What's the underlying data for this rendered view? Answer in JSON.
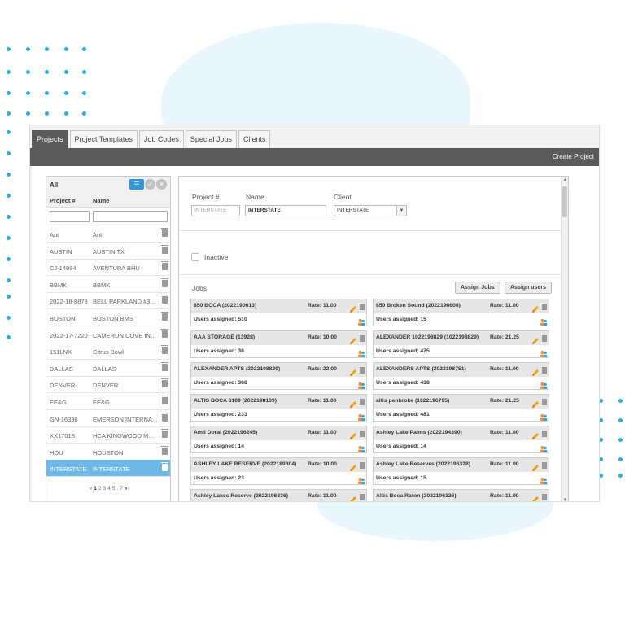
{
  "tabs": [
    "Projects",
    "Project Templates",
    "Job Codes",
    "Special Jobs",
    "Clients"
  ],
  "active_tab": 0,
  "toolbar": {
    "create_project": "Create Project"
  },
  "list": {
    "filter_label": "All",
    "col_project": "Project #",
    "col_name": "Name",
    "filter_icons": [
      "list-icon",
      "check-circle-icon",
      "close-circle-icon"
    ],
    "rows": [
      {
        "num": "Ant",
        "name": "Ant"
      },
      {
        "num": "AUSTIN",
        "name": "AUSTIN TX"
      },
      {
        "num": "CJ-14984",
        "name": "AVENTURA BHU"
      },
      {
        "num": "BBMK",
        "name": "BBMK"
      },
      {
        "num": "2022-18-8879",
        "name": "BELL PARKLAND #3215"
      },
      {
        "num": "BOSTON",
        "name": "BOSTON BMS"
      },
      {
        "num": "2022-17-7220",
        "name": "CAMERUN COVE INT..."
      },
      {
        "num": "151LNX",
        "name": "Citrus Bowl"
      },
      {
        "num": "DALLAS",
        "name": "DALLAS"
      },
      {
        "num": "DENVER",
        "name": "DENVER"
      },
      {
        "num": "EE&G",
        "name": "EE&G"
      },
      {
        "num": "GN-16336",
        "name": "EMERSON INTERNAT..."
      },
      {
        "num": "XX17018",
        "name": "HCA KINGWOOD MED..."
      },
      {
        "num": "HOU",
        "name": "HOUSTON"
      },
      {
        "num": "INTERSTATE",
        "name": "INTERSTATE"
      }
    ],
    "selected_index": 14,
    "pager": {
      "prev": "«",
      "pages": [
        "1",
        "2",
        "3",
        "4",
        "5",
        ".",
        "7"
      ],
      "current": "1",
      "next": "»"
    }
  },
  "detail": {
    "project_label": "Project #",
    "name_label": "Name",
    "client_label": "Client",
    "project_value": "INTERSTATE",
    "name_value": "INTERSTATE",
    "client_value": "INTERSTATE",
    "inactive_label": "Inactive",
    "jobs_label": "Jobs",
    "assign_jobs": "Assign Jobs",
    "assign_users": "Assign users",
    "jobs": [
      {
        "name": "850 BOCA (2022190613)",
        "rate": "Rate: 11.00",
        "users": "Users assigned: 510"
      },
      {
        "name": "850 Broken Sound (2022196608)",
        "rate": "Rate: 11.00",
        "users": "Users assigned: 15"
      },
      {
        "name": "AAA STORAGE (13928)",
        "rate": "Rate: 10.00",
        "users": "Users assigned: 38"
      },
      {
        "name": "ALEXANDER 1022198829 (1022198829)",
        "rate": "Rate: 21.25",
        "users": "Users assigned: 475"
      },
      {
        "name": "ALEXANDER APTS (2022198829)",
        "rate": "Rate: 22.00",
        "users": "Users assigned: 368"
      },
      {
        "name": "ALEXANDERS APTS (2022198751)",
        "rate": "Rate: 11.00",
        "users": "Users assigned: 438"
      },
      {
        "name": "ALTIS BOCA 8109 (2022198109)",
        "rate": "Rate: 11.00",
        "users": "Users assigned: 233"
      },
      {
        "name": "altis penbroke (1022196795)",
        "rate": "Rate: 21.25",
        "users": "Users assigned: 481"
      },
      {
        "name": "Amli Doral (2022196245)",
        "rate": "Rate: 11.00",
        "users": "Users assigned: 14"
      },
      {
        "name": "Ashley Lake Palms (2022194390)",
        "rate": "Rate: 11.00",
        "users": "Users assigned: 14"
      },
      {
        "name": "ASHLEY LAKE RESERVE (2022189304)",
        "rate": "Rate: 10.00",
        "users": "Users assigned: 23"
      },
      {
        "name": "Ashley Lake Reserves (2022196328)",
        "rate": "Rate: 11.00",
        "users": "Users assigned: 15"
      },
      {
        "name": "Ashley Lakes Reserve (2022196336)",
        "rate": "Rate: 11.00",
        "users": ""
      },
      {
        "name": "Altis Boca Raton (2022196326)",
        "rate": "Rate: 11.00",
        "users": ""
      }
    ]
  },
  "colors": {
    "accent": "#2f96d6",
    "selected_row": "#6eb8e6",
    "toolbar": "#5a5a5a",
    "dots": "#29aee6"
  }
}
